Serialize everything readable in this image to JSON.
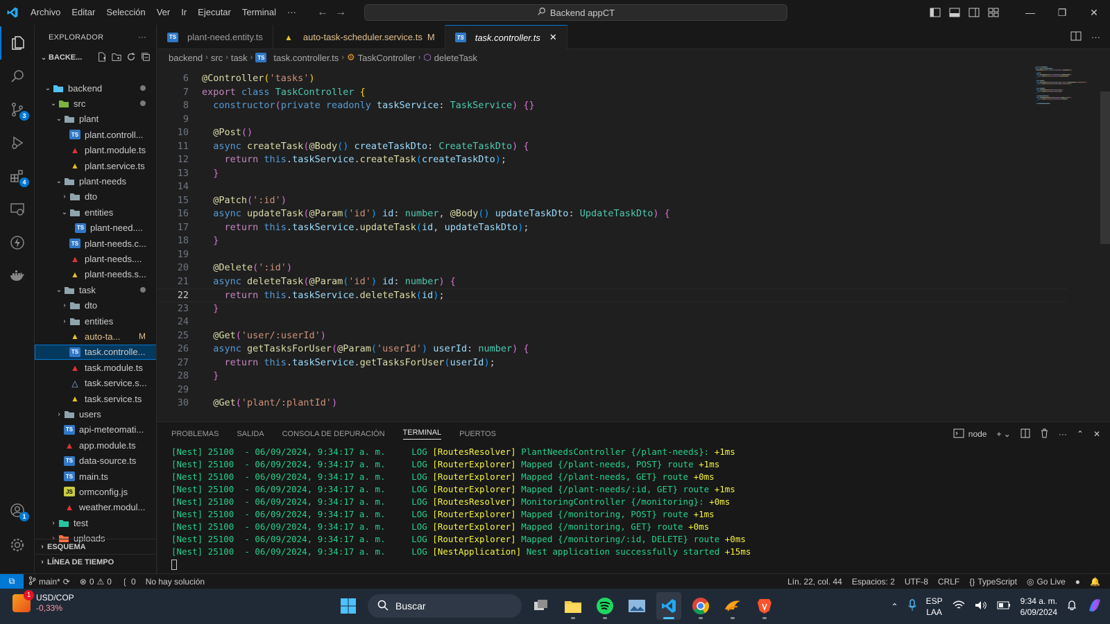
{
  "titlebar": {
    "menus": [
      "Archivo",
      "Editar",
      "Selección",
      "Ver",
      "Ir",
      "Ejecutar",
      "Terminal",
      "···"
    ],
    "search_text": "Backend appCT"
  },
  "activity_badges": {
    "source_control": "3",
    "extensions": "4",
    "accounts": "1"
  },
  "sidebar": {
    "title": "EXPLORADOR",
    "root": "BACKE...",
    "tree": [
      {
        "label": "backend",
        "icon": "folder-special",
        "chev": "down",
        "indent": 1,
        "dot": true
      },
      {
        "label": "src",
        "icon": "folder-src",
        "chev": "down",
        "indent": 2,
        "dot": true
      },
      {
        "label": "plant",
        "icon": "folder",
        "chev": "down",
        "indent": 3
      },
      {
        "label": "plant.controll...",
        "icon": "ts",
        "indent": 4
      },
      {
        "label": "plant.module.ts",
        "icon": "angular",
        "indent": 4
      },
      {
        "label": "plant.service.ts",
        "icon": "service",
        "indent": 4
      },
      {
        "label": "plant-needs",
        "icon": "folder",
        "chev": "down",
        "indent": 3
      },
      {
        "label": "dto",
        "icon": "folder",
        "chev": "right",
        "indent": 4
      },
      {
        "label": "entities",
        "icon": "folder",
        "chev": "down",
        "indent": 4
      },
      {
        "label": "plant-need....",
        "icon": "ts",
        "indent": 5
      },
      {
        "label": "plant-needs.c...",
        "icon": "ts",
        "indent": 4
      },
      {
        "label": "plant-needs....",
        "icon": "angular",
        "indent": 4
      },
      {
        "label": "plant-needs.s...",
        "icon": "service",
        "indent": 4
      },
      {
        "label": "task",
        "icon": "folder",
        "chev": "down",
        "indent": 3,
        "dot": true
      },
      {
        "label": "dto",
        "icon": "folder",
        "chev": "right",
        "indent": 4
      },
      {
        "label": "entities",
        "icon": "folder",
        "chev": "right",
        "indent": 4
      },
      {
        "label": "auto-ta...",
        "icon": "service",
        "indent": 4,
        "modified": "M"
      },
      {
        "label": "task.controlle...",
        "icon": "ts",
        "indent": 4,
        "selected": true
      },
      {
        "label": "task.module.ts",
        "icon": "angular",
        "indent": 4
      },
      {
        "label": "task.service.s...",
        "icon": "test",
        "indent": 4
      },
      {
        "label": "task.service.ts",
        "icon": "service",
        "indent": 4
      },
      {
        "label": "users",
        "icon": "folder",
        "chev": "right",
        "indent": 3
      },
      {
        "label": "api-meteomati...",
        "icon": "ts",
        "indent": 3
      },
      {
        "label": "app.module.ts",
        "icon": "angular",
        "indent": 3
      },
      {
        "label": "data-source.ts",
        "icon": "ts",
        "indent": 3
      },
      {
        "label": "main.ts",
        "icon": "ts",
        "indent": 3
      },
      {
        "label": "ormconfig.js",
        "icon": "js",
        "indent": 3
      },
      {
        "label": "weather.modul...",
        "icon": "angular",
        "indent": 3
      },
      {
        "label": "test",
        "icon": "folder-test",
        "chev": "right",
        "indent": 2
      },
      {
        "label": "uploads",
        "icon": "folder-uploads",
        "chev": "right",
        "indent": 2
      }
    ],
    "sections": [
      "ESQUEMA",
      "LÍNEA DE TIEMPO"
    ]
  },
  "tabs": [
    {
      "label": "plant-need.entity.ts",
      "icon": "ts"
    },
    {
      "label": "auto-task-scheduler.service.ts",
      "icon": "service",
      "modified": "M"
    },
    {
      "label": "task.controller.ts",
      "icon": "ts",
      "active": true
    }
  ],
  "breadcrumb": [
    "backend",
    "src",
    "task",
    "task.controller.ts",
    "TaskController",
    "deleteTask"
  ],
  "editor": {
    "first_line": 6,
    "current_line": 22,
    "lines": [
      [
        [
          "@Controller",
          "dec"
        ],
        [
          "(",
          "p1"
        ],
        [
          "'tasks'",
          "str"
        ],
        [
          ")",
          "p1"
        ]
      ],
      [
        [
          "export ",
          "ctrl"
        ],
        [
          "class ",
          "kw"
        ],
        [
          "TaskController ",
          "cls"
        ],
        [
          "{",
          "p1"
        ]
      ],
      [
        [
          "  ",
          "def"
        ],
        [
          "constructor",
          "kw"
        ],
        [
          "(",
          "p2"
        ],
        [
          "private ",
          "kw"
        ],
        [
          "readonly ",
          "kw"
        ],
        [
          "taskService",
          "var"
        ],
        [
          ": ",
          "def"
        ],
        [
          "TaskService",
          "cls"
        ],
        [
          ") ",
          "p2"
        ],
        [
          "{}",
          "p2"
        ]
      ],
      [],
      [
        [
          "  @Post",
          "dec"
        ],
        [
          "()",
          "p2"
        ]
      ],
      [
        [
          "  async ",
          "kw"
        ],
        [
          "createTask",
          "fn"
        ],
        [
          "(",
          "p2"
        ],
        [
          "@Body",
          "dec"
        ],
        [
          "() ",
          "p3"
        ],
        [
          "createTaskDto",
          "var"
        ],
        [
          ": ",
          "def"
        ],
        [
          "CreateTaskDto",
          "cls"
        ],
        [
          ") ",
          "p2"
        ],
        [
          "{",
          "p2"
        ]
      ],
      [
        [
          "    return ",
          "ctrl"
        ],
        [
          "this",
          "kw"
        ],
        [
          ".",
          "def"
        ],
        [
          "taskService",
          "var"
        ],
        [
          ".",
          "def"
        ],
        [
          "createTask",
          "fn"
        ],
        [
          "(",
          "p3"
        ],
        [
          "createTaskDto",
          "var"
        ],
        [
          ")",
          "p3"
        ],
        [
          ";",
          "def"
        ]
      ],
      [
        [
          "  }",
          "p2"
        ]
      ],
      [],
      [
        [
          "  @Patch",
          "dec"
        ],
        [
          "(",
          "p2"
        ],
        [
          "':id'",
          "str"
        ],
        [
          ")",
          "p2"
        ]
      ],
      [
        [
          "  async ",
          "kw"
        ],
        [
          "updateTask",
          "fn"
        ],
        [
          "(",
          "p2"
        ],
        [
          "@Param",
          "dec"
        ],
        [
          "(",
          "p3"
        ],
        [
          "'id'",
          "str"
        ],
        [
          ") ",
          "p3"
        ],
        [
          "id",
          "var"
        ],
        [
          ": ",
          "def"
        ],
        [
          "number",
          "cls"
        ],
        [
          ", ",
          "def"
        ],
        [
          "@Body",
          "dec"
        ],
        [
          "() ",
          "p3"
        ],
        [
          "updateTaskDto",
          "var"
        ],
        [
          ": ",
          "def"
        ],
        [
          "UpdateTaskDto",
          "cls"
        ],
        [
          ") ",
          "p2"
        ],
        [
          "{",
          "p2"
        ]
      ],
      [
        [
          "    return ",
          "ctrl"
        ],
        [
          "this",
          "kw"
        ],
        [
          ".",
          "def"
        ],
        [
          "taskService",
          "var"
        ],
        [
          ".",
          "def"
        ],
        [
          "updateTask",
          "fn"
        ],
        [
          "(",
          "p3"
        ],
        [
          "id",
          "var"
        ],
        [
          ", ",
          "def"
        ],
        [
          "updateTaskDto",
          "var"
        ],
        [
          ")",
          "p3"
        ],
        [
          ";",
          "def"
        ]
      ],
      [
        [
          "  }",
          "p2"
        ]
      ],
      [],
      [
        [
          "  @Delete",
          "dec"
        ],
        [
          "(",
          "p2"
        ],
        [
          "':id'",
          "str"
        ],
        [
          ")",
          "p2"
        ]
      ],
      [
        [
          "  async ",
          "kw"
        ],
        [
          "deleteTask",
          "fn"
        ],
        [
          "(",
          "p2"
        ],
        [
          "@Param",
          "dec"
        ],
        [
          "(",
          "p3"
        ],
        [
          "'id'",
          "str"
        ],
        [
          ") ",
          "p3"
        ],
        [
          "id",
          "var"
        ],
        [
          ": ",
          "def"
        ],
        [
          "number",
          "cls"
        ],
        [
          ") ",
          "p2"
        ],
        [
          "{",
          "p2"
        ]
      ],
      [
        [
          "    return ",
          "ctrl"
        ],
        [
          "this",
          "kw"
        ],
        [
          ".",
          "def"
        ],
        [
          "taskService",
          "var"
        ],
        [
          ".",
          "def"
        ],
        [
          "deleteTask",
          "fn"
        ],
        [
          "(",
          "p3"
        ],
        [
          "id",
          "var"
        ],
        [
          ")",
          "p3"
        ],
        [
          ";",
          "def"
        ]
      ],
      [
        [
          "  }",
          "p2"
        ]
      ],
      [],
      [
        [
          "  @Get",
          "dec"
        ],
        [
          "(",
          "p2"
        ],
        [
          "'user/:userId'",
          "str"
        ],
        [
          ")",
          "p2"
        ]
      ],
      [
        [
          "  async ",
          "kw"
        ],
        [
          "getTasksForUser",
          "fn"
        ],
        [
          "(",
          "p2"
        ],
        [
          "@Param",
          "dec"
        ],
        [
          "(",
          "p3"
        ],
        [
          "'userId'",
          "str"
        ],
        [
          ") ",
          "p3"
        ],
        [
          "userId",
          "var"
        ],
        [
          ": ",
          "def"
        ],
        [
          "number",
          "cls"
        ],
        [
          ") ",
          "p2"
        ],
        [
          "{",
          "p2"
        ]
      ],
      [
        [
          "    return ",
          "ctrl"
        ],
        [
          "this",
          "kw"
        ],
        [
          ".",
          "def"
        ],
        [
          "taskService",
          "var"
        ],
        [
          ".",
          "def"
        ],
        [
          "getTasksForUser",
          "fn"
        ],
        [
          "(",
          "p3"
        ],
        [
          "userId",
          "var"
        ],
        [
          ")",
          "p3"
        ],
        [
          ";",
          "def"
        ]
      ],
      [
        [
          "  }",
          "p2"
        ]
      ],
      [],
      [
        [
          "  @Get",
          "dec"
        ],
        [
          "(",
          "p2"
        ],
        [
          "'plant/:plantId'",
          "str"
        ],
        [
          ")",
          "p2"
        ]
      ]
    ]
  },
  "panel": {
    "tabs": [
      "PROBLEMAS",
      "SALIDA",
      "CONSOLA DE DEPURACIÓN",
      "TERMINAL",
      "PUERTOS"
    ],
    "active_tab": "TERMINAL",
    "terminal_name": "node",
    "log_lines": [
      {
        "ctx": "[RoutesResolver]",
        "msg": "PlantNeedsController {/plant-needs}:",
        "time": "+1ms"
      },
      {
        "ctx": "[RouterExplorer]",
        "msg": "Mapped {/plant-needs, POST} route",
        "time": "+1ms"
      },
      {
        "ctx": "[RouterExplorer]",
        "msg": "Mapped {/plant-needs, GET} route",
        "time": "+0ms"
      },
      {
        "ctx": "[RouterExplorer]",
        "msg": "Mapped {/plant-needs/:id, GET} route",
        "time": "+1ms"
      },
      {
        "ctx": "[RoutesResolver]",
        "msg": "MonitoringController {/monitoring}:",
        "time": "+0ms"
      },
      {
        "ctx": "[RouterExplorer]",
        "msg": "Mapped {/monitoring, POST} route",
        "time": "+1ms"
      },
      {
        "ctx": "[RouterExplorer]",
        "msg": "Mapped {/monitoring, GET} route",
        "time": "+0ms"
      },
      {
        "ctx": "[RouterExplorer]",
        "msg": "Mapped {/monitoring/:id, DELETE} route",
        "time": "+0ms"
      },
      {
        "ctx": "[NestApplication]",
        "msg": "Nest application successfully started",
        "time": "+15ms"
      }
    ],
    "log_prefix": "[Nest] 25100  - 06/09/2024, 9:34:17 a. m.     LOG "
  },
  "statusbar": {
    "branch": "main*",
    "errors": "0",
    "warnings": "0",
    "ports": "0",
    "solution": "No hay solución",
    "position": "Lín. 22, col. 44",
    "spaces": "Espacios: 2",
    "encoding": "UTF-8",
    "eol": "CRLF",
    "language": "TypeScript",
    "golive": "Go Live"
  },
  "taskbar": {
    "weather_title": "USD/COP",
    "weather_change": "-0,33%",
    "weather_badge": "1",
    "search_label": "Buscar",
    "lang_top": "ESP",
    "lang_bottom": "LAA",
    "time": "9:34 a. m.",
    "date": "6/09/2024"
  },
  "colors": {
    "accent": "#0078d4",
    "modified": "#e2c08d",
    "terminal_green": "#23d18b",
    "terminal_yellow": "#f5f543"
  }
}
